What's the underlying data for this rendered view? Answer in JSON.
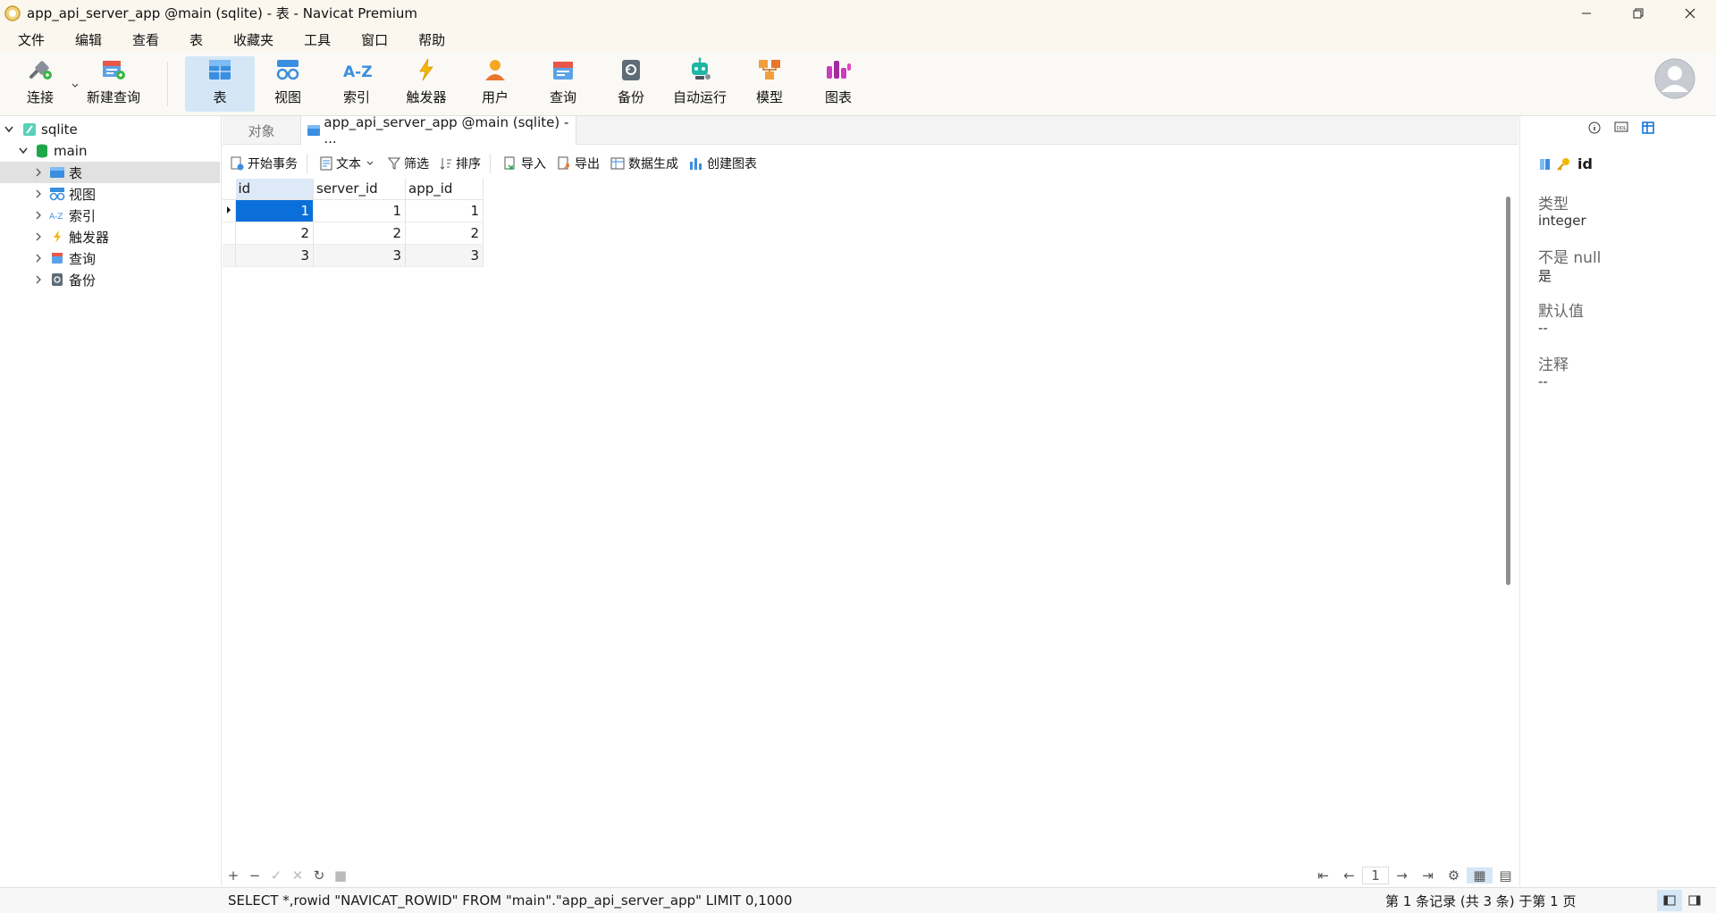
{
  "window": {
    "title": "app_api_server_app @main (sqlite) - 表 - Navicat Premium"
  },
  "menu": [
    "文件",
    "编辑",
    "查看",
    "表",
    "收藏夹",
    "工具",
    "窗口",
    "帮助"
  ],
  "toolbar": {
    "connect": "连接",
    "new_query": "新建查询",
    "table": "表",
    "view": "视图",
    "index": "索引",
    "trigger": "触发器",
    "user": "用户",
    "query": "查询",
    "backup": "备份",
    "automation": "自动运行",
    "model": "模型",
    "chart": "图表"
  },
  "nav": {
    "connection": "sqlite",
    "database": "main",
    "items": [
      "表",
      "视图",
      "索引",
      "触发器",
      "查询",
      "备份"
    ]
  },
  "tabs": {
    "objects": "对象",
    "active": "app_api_server_app @main (sqlite) - ..."
  },
  "subtoolbar": {
    "begin_tx": "开始事务",
    "text": "文本",
    "filter": "筛选",
    "sort": "排序",
    "import": "导入",
    "export": "导出",
    "data_gen": "数据生成",
    "create_chart": "创建图表"
  },
  "grid": {
    "columns": [
      "id",
      "server_id",
      "app_id"
    ],
    "rows": [
      [
        "1",
        "1",
        "1"
      ],
      [
        "2",
        "2",
        "2"
      ],
      [
        "3",
        "3",
        "3"
      ]
    ]
  },
  "footer": {
    "page": "1"
  },
  "panel": {
    "field": "id",
    "type_label": "类型",
    "type_value": "integer",
    "notnull_label": "不是 null",
    "notnull_value": "是",
    "default_label": "默认值",
    "default_value": "--",
    "comment_label": "注释",
    "comment_value": "--"
  },
  "status": {
    "sql": "SELECT *,rowid \"NAVICAT_ROWID\" FROM \"main\".\"app_api_server_app\" LIMIT 0,1000",
    "records": "第 1 条记录 (共 3 条) 于第 1 页"
  },
  "colors": {
    "selection": "#0a6fd8",
    "active_tool": "#d5e7f7",
    "titlebar": "#fbf6ee"
  }
}
